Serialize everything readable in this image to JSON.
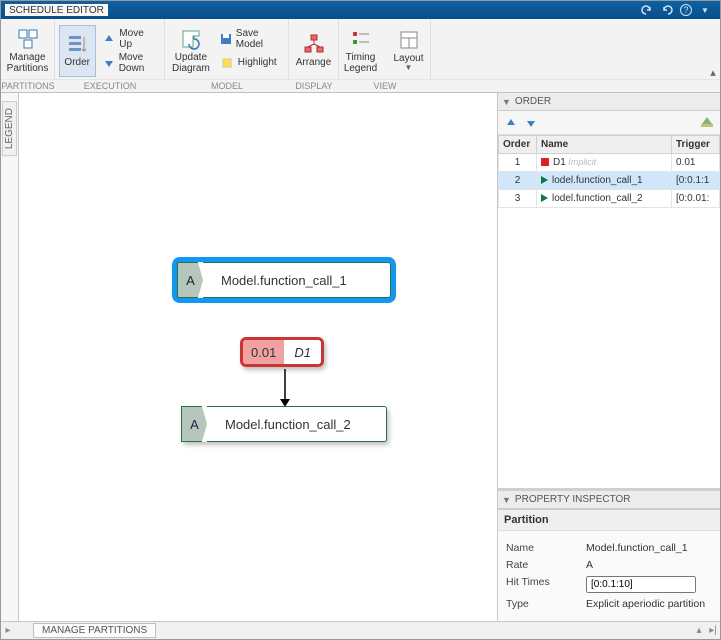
{
  "title": "SCHEDULE EDITOR",
  "ribbon": {
    "partitions": {
      "manage": "Manage\nPartitions"
    },
    "execution": {
      "order": "Order",
      "move_up": "Move Up",
      "move_down": "Move Down"
    },
    "model": {
      "update": "Update\nDiagram",
      "save": "Save Model",
      "highlight": "Highlight"
    },
    "display": {
      "arrange": "Arrange"
    },
    "view": {
      "timing": "Timing\nLegend",
      "layout": "Layout"
    },
    "section_labels": {
      "partitions": "PARTITIONS",
      "execution": "EXECUTION",
      "model": "MODEL",
      "display": "DISPLAY",
      "view": "VIEW"
    }
  },
  "legend_bar": "LEGEND",
  "canvas": {
    "node1": {
      "badge": "A",
      "label": "Model.function_call_1"
    },
    "periodic": {
      "rate": "0.01",
      "name": "D1"
    },
    "node2": {
      "badge": "A",
      "label": "Model.function_call_2"
    }
  },
  "order_panel": {
    "title": "ORDER",
    "columns": {
      "order": "Order",
      "name": "Name",
      "trigger": "Trigger"
    },
    "rows": [
      {
        "order": "1",
        "name": "D1",
        "hint": "Implicit",
        "trigger": "0.01",
        "icon": "red",
        "selected": false
      },
      {
        "order": "2",
        "name": "lodel.function_call_1",
        "trigger": "[0:0.1:1",
        "icon": "green",
        "selected": true
      },
      {
        "order": "3",
        "name": "lodel.function_call_2",
        "trigger": "[0:0.01:",
        "icon": "green",
        "selected": false
      }
    ]
  },
  "property_inspector": {
    "title": "PROPERTY INSPECTOR",
    "section": "Partition",
    "rows": {
      "name": {
        "k": "Name",
        "v": "Model.function_call_1"
      },
      "rate": {
        "k": "Rate",
        "v": "A"
      },
      "hit": {
        "k": "Hit Times",
        "v": "[0:0.1:10]"
      },
      "type": {
        "k": "Type",
        "v": "Explicit aperiodic partition"
      }
    }
  },
  "statusbar": {
    "tab": "MANAGE PARTITIONS"
  }
}
